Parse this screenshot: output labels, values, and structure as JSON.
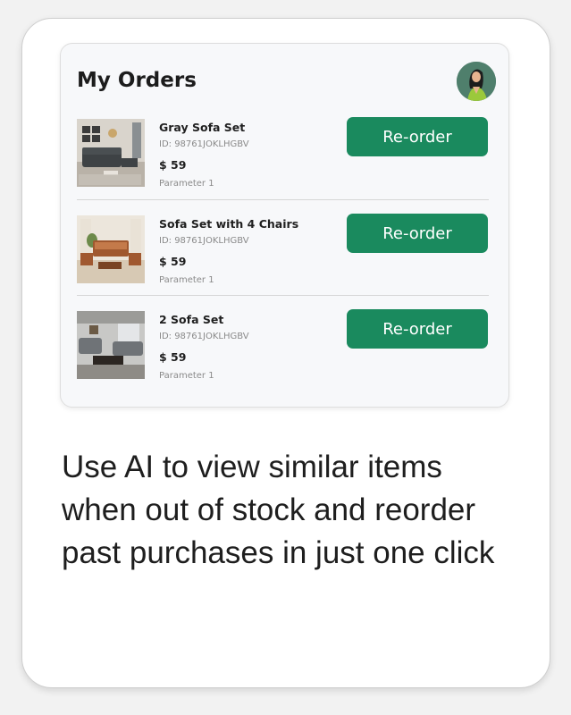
{
  "panel": {
    "title": "My Orders",
    "avatar_icon": "user-avatar-icon"
  },
  "orders": [
    {
      "name": "Gray Sofa Set",
      "id": "ID: 98761JOKLHGBV",
      "price": "$ 59",
      "param": "Parameter 1",
      "button": "Re-order",
      "image": "gray-sofa-set-photo"
    },
    {
      "name": "Sofa Set with 4 Chairs",
      "id": "ID: 98761JOKLHGBV",
      "price": "$ 59",
      "param": "Parameter 1",
      "button": "Re-order",
      "image": "wooden-sofa-set-photo"
    },
    {
      "name": "2 Sofa Set",
      "id": "ID: 98761JOKLHGBV",
      "price": "$ 59",
      "param": "Parameter 1",
      "button": "Re-order",
      "image": "two-sofa-set-photo"
    }
  ],
  "caption": "Use AI to view similar items when out of stock and reorder past purchases in just one click",
  "colors": {
    "accent": "#1a8a5e",
    "panel_bg": "#f7f8fa",
    "text": "#1e1e1e",
    "muted": "#8a8a8a"
  }
}
